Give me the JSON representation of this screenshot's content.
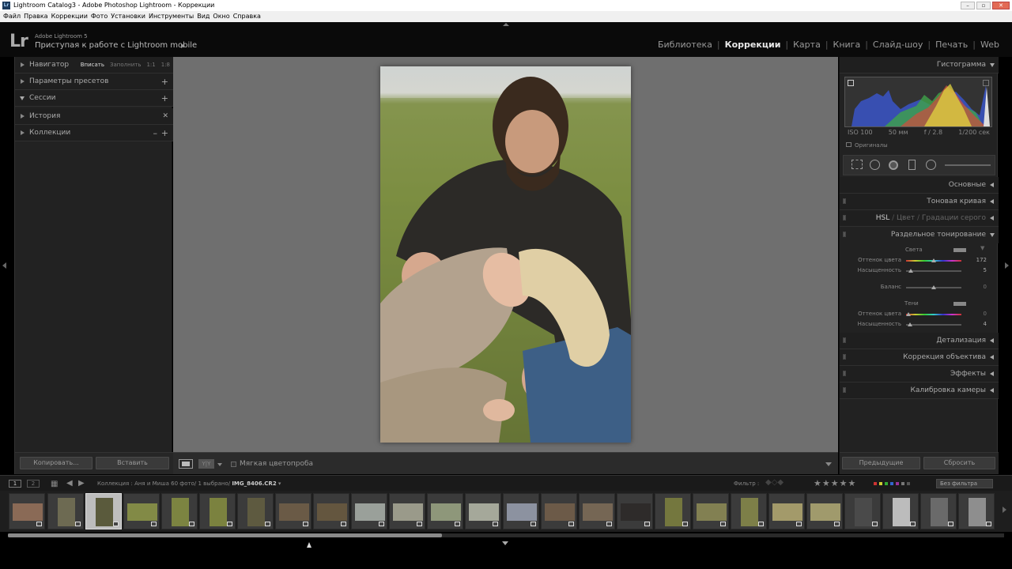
{
  "window": {
    "title": "Lightroom Catalog3 - Adobe Photoshop Lightroom - Коррекции"
  },
  "menubar": [
    "Файл",
    "Правка",
    "Коррекции",
    "Фото",
    "Установки",
    "Инструменты",
    "Вид",
    "Окно",
    "Справка"
  ],
  "identity": {
    "logo": "Lr",
    "version": "Adobe Lightroom 5",
    "subtitle": "Приступая к работе с Lightroom mobile"
  },
  "modules": [
    {
      "label": "Библиотека",
      "active": false
    },
    {
      "label": "Коррекции",
      "active": true
    },
    {
      "label": "Карта",
      "active": false
    },
    {
      "label": "Книга",
      "active": false
    },
    {
      "label": "Слайд-шоу",
      "active": false
    },
    {
      "label": "Печать",
      "active": false
    },
    {
      "label": "Web",
      "active": false
    }
  ],
  "left_panel": {
    "navigator": {
      "label": "Навигатор",
      "options": [
        "Вписать",
        "Заполнить",
        "1:1",
        "1:8"
      ]
    },
    "presets": "Параметры пресетов",
    "snapshots": "Сессии",
    "history": "История",
    "collections": "Коллекции",
    "copy_button": "Копировать...",
    "paste_button": "Вставить"
  },
  "toolbar": {
    "yy_label": "Y|Y",
    "soft_proof": "Мягкая цветопроба"
  },
  "right_panel": {
    "histogram": "Гистограмма",
    "exif": [
      "ISO 100",
      "50 мм",
      "f / 2.8",
      "1/200 сек"
    ],
    "originals": "Оригиналы",
    "basic": "Основные",
    "tone_curve": "Тоновая кривая",
    "hsl": {
      "active": "HSL",
      "color": "Цвет",
      "grayscale": "Градации серого",
      "sep": "/"
    },
    "split_toning": {
      "title": "Раздельное тонирование",
      "highlights": "Света",
      "shadows": "Тени",
      "hue": "Оттенок цвета",
      "saturation": "Насыщенность",
      "balance": "Баланс",
      "values": {
        "hl_hue": "172",
        "hl_sat": "5",
        "balance": "0",
        "sh_hue": "0",
        "sh_sat": "4"
      }
    },
    "detail": "Детализация",
    "lens": "Коррекция объектива",
    "effects": "Эффекты",
    "calibration": "Калибровка камеры",
    "previous_button": "Предыдущие",
    "reset_button": "Сбросить"
  },
  "filmstrip_header": {
    "page1": "1",
    "page2": "2",
    "collection": "Коллекция : Аня и Миша  60 фото/  1 выбрано/ ",
    "filename": "IMG_8406.CR2",
    "filter_label": "Фильтр :",
    "stars": "★★★★★",
    "no_filter": "Без фильтра"
  },
  "colors": {
    "panel": "#222222",
    "center": "#6f6f6f",
    "accent_text": "#e8e8e8"
  }
}
